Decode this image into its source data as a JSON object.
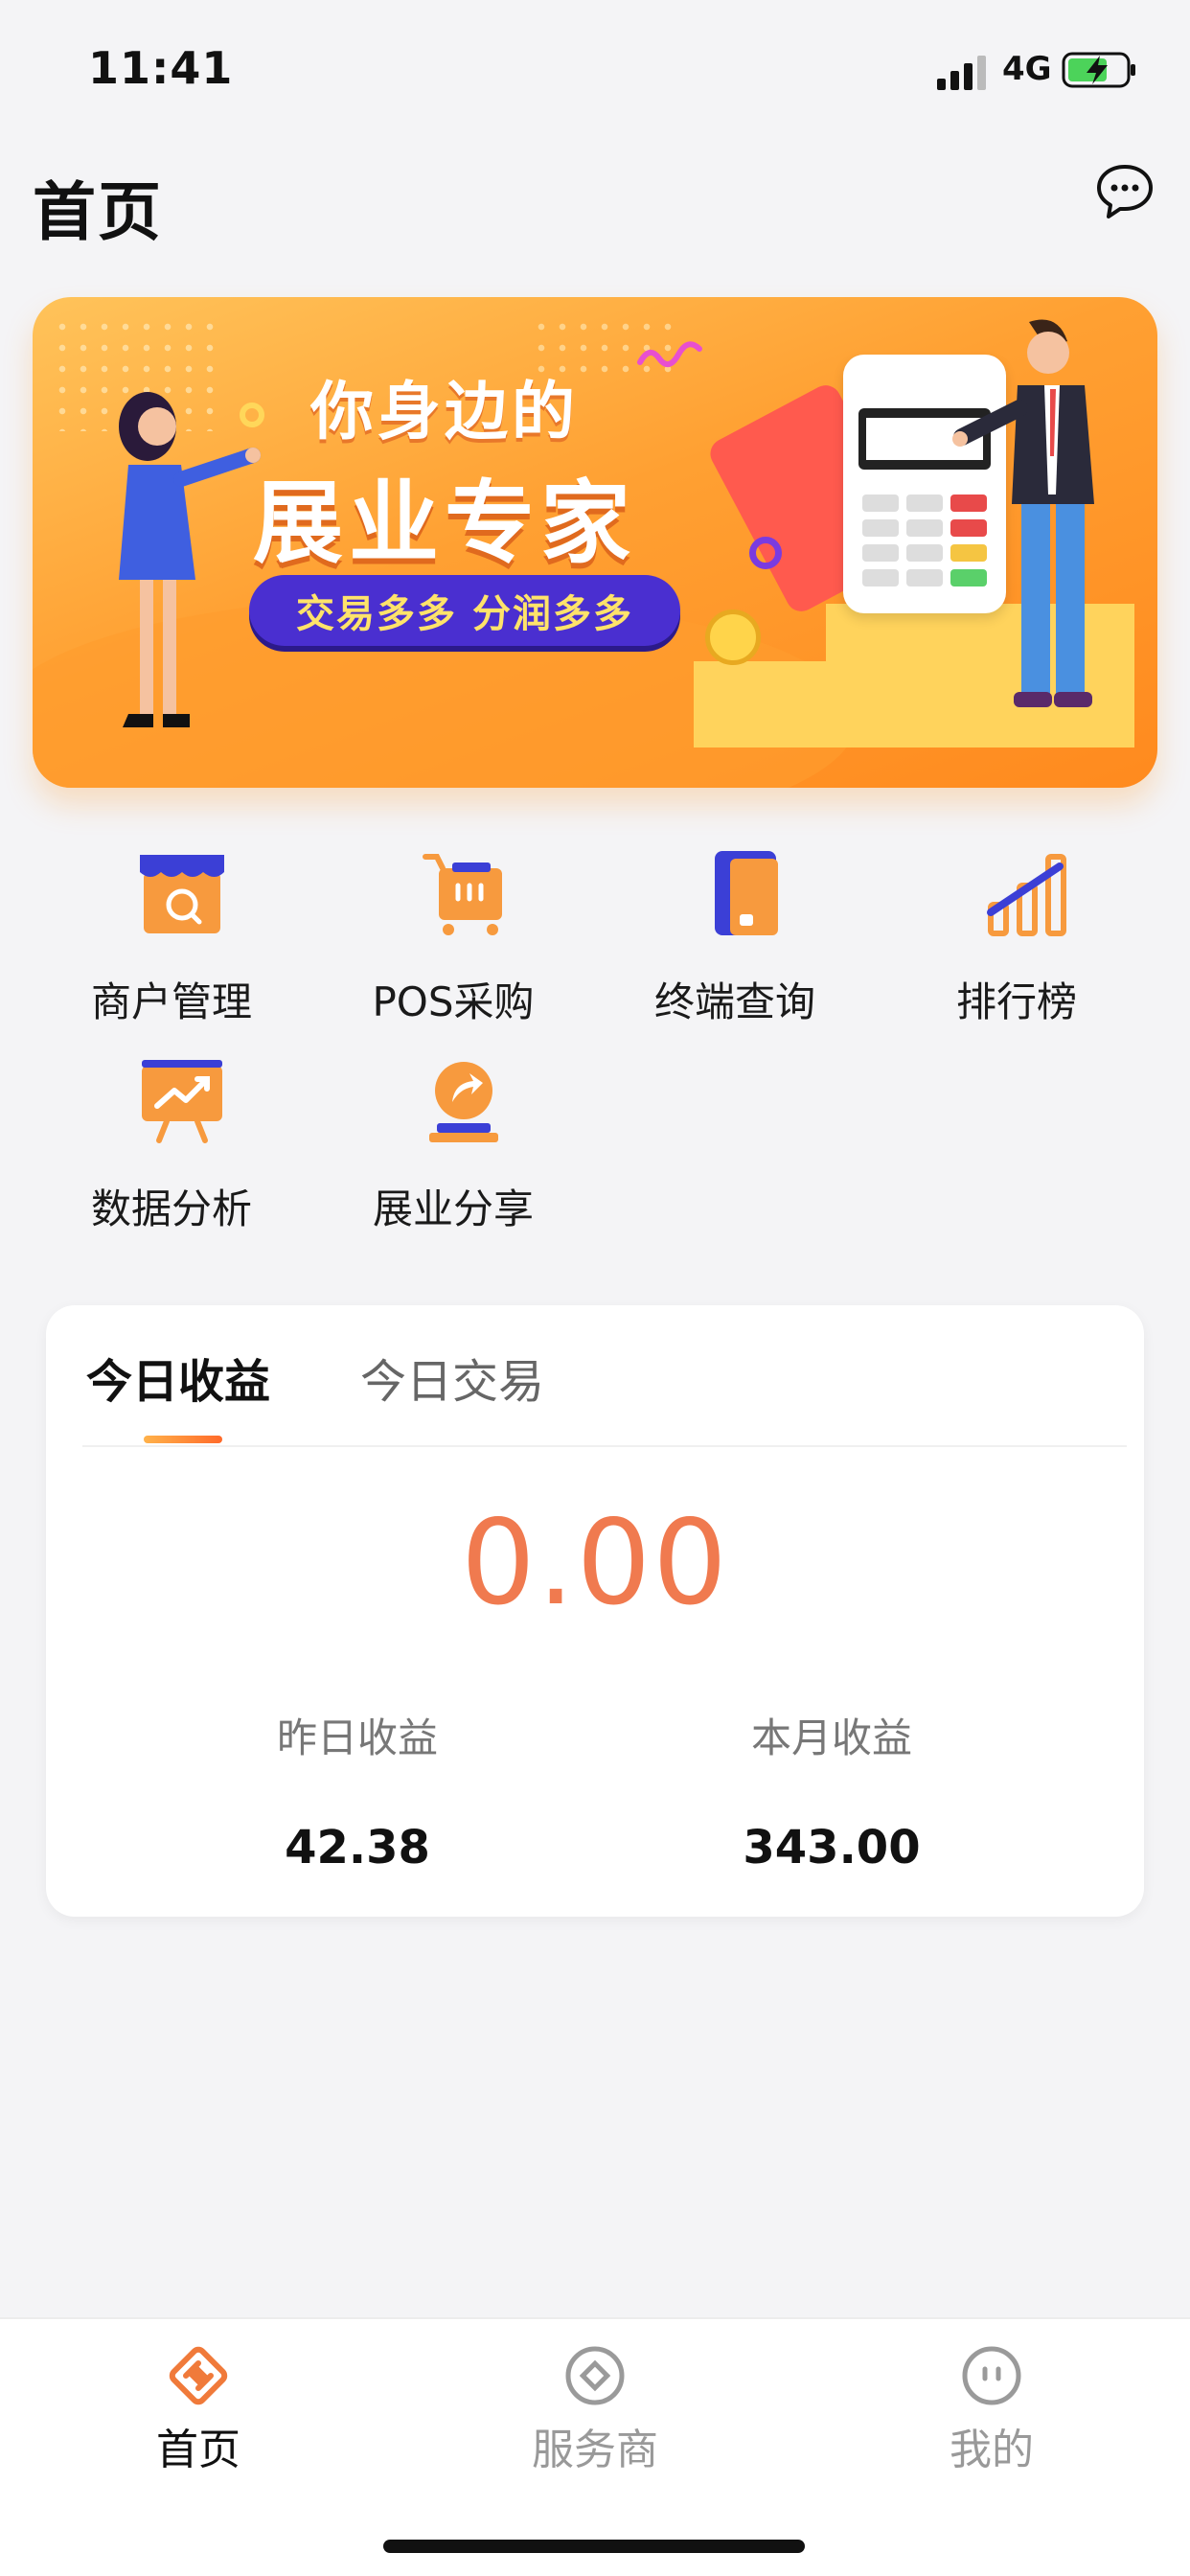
{
  "status_bar": {
    "time": "11:41",
    "network": "4G"
  },
  "header": {
    "title": "首页",
    "message_icon": "chat-bubble-icon"
  },
  "banner": {
    "headline_small": "你身边的",
    "headline_large": "展业专家",
    "pill_text": "交易多多  分润多多",
    "colors": {
      "bg_start": "#ffc35a",
      "bg_end": "#ff8a1e",
      "pill": "#4a2fd0",
      "pill_text": "#ffe36a"
    }
  },
  "menu": [
    {
      "label": "商户管理",
      "icon": "merchant-store-icon"
    },
    {
      "label": "POS采购",
      "icon": "shopping-cart-icon"
    },
    {
      "label": "终端查询",
      "icon": "terminal-device-icon"
    },
    {
      "label": "排行榜",
      "icon": "ranking-bars-icon"
    },
    {
      "label": "数据分析",
      "icon": "data-chart-board-icon"
    },
    {
      "label": "展业分享",
      "icon": "share-arrow-icon"
    }
  ],
  "earnings": {
    "tabs": [
      "今日收益",
      "今日交易"
    ],
    "active_tab": "今日收益",
    "today_value": "0.00",
    "yesterday_label": "昨日收益",
    "yesterday_value": "42.38",
    "month_label": "本月收益",
    "month_value": "343.00",
    "accent_color": "#f07a4f"
  },
  "tab_bar": {
    "items": [
      {
        "label": "首页",
        "icon": "home-diamond-icon",
        "active": true
      },
      {
        "label": "服务商",
        "icon": "service-provider-icon",
        "active": false
      },
      {
        "label": "我的",
        "icon": "profile-face-icon",
        "active": false
      }
    ],
    "active_color": "#f07a3a",
    "inactive_color": "#9a9a9a"
  }
}
